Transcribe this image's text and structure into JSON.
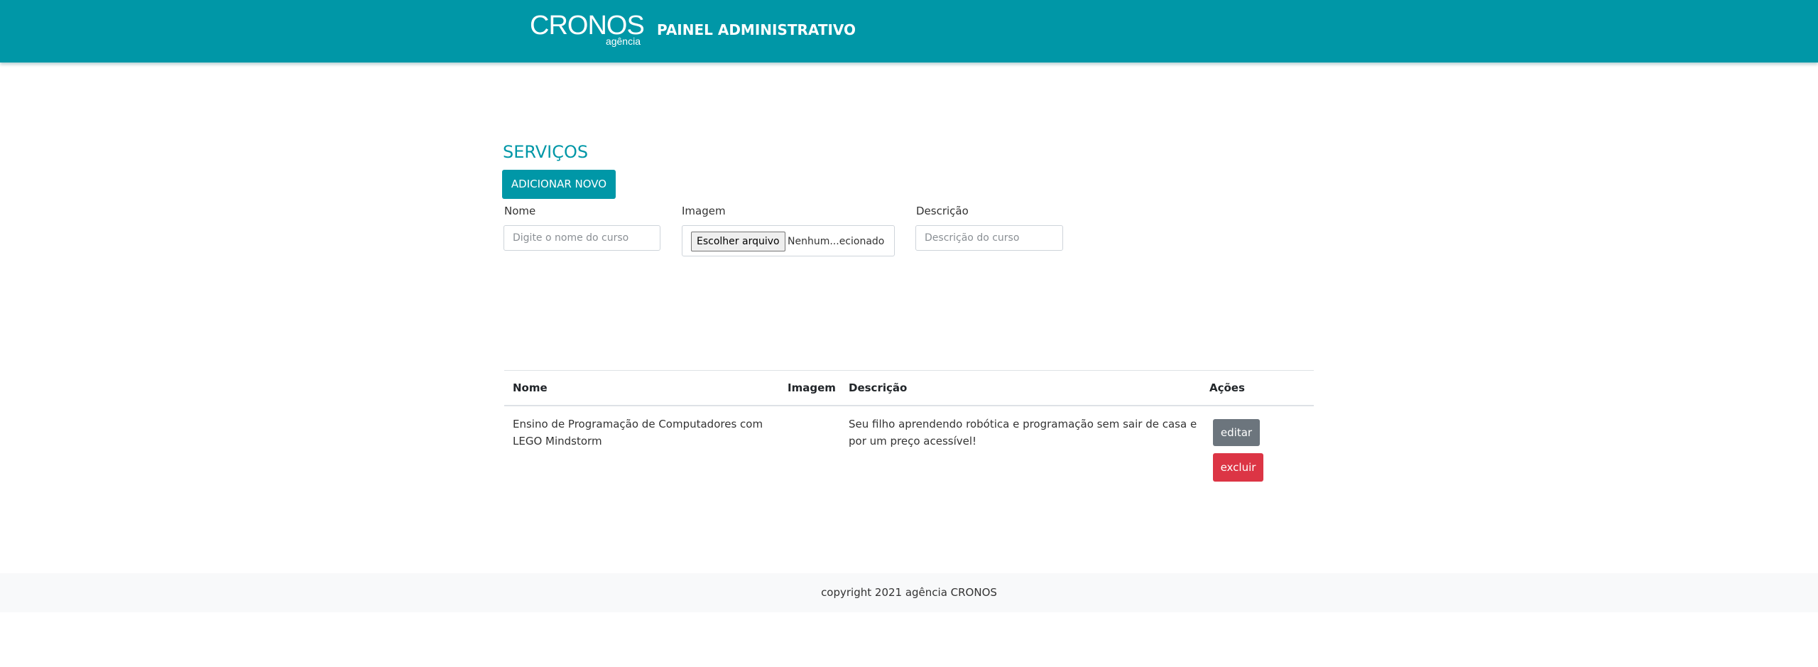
{
  "header": {
    "logo_main": "CRONOS",
    "logo_sub": "agência",
    "title": "PAINEL ADMINISTRATIVO",
    "background_color": "#0097a7"
  },
  "main": {
    "heading": "SERVIÇOS",
    "add_button_label": "ADICIONAR NOVO",
    "form": {
      "name_label": "Nome",
      "name_placeholder": "Digite o nome do curso",
      "image_label": "Imagem",
      "file_button_label": "Escolher arquivo",
      "file_status": "Nenhum...ecionado",
      "description_label": "Descrição",
      "description_placeholder": "Descrição do curso"
    },
    "table": {
      "columns": [
        "Nome",
        "Imagem",
        "Descrição",
        "Ações"
      ],
      "rows": [
        {
          "nome_line1": "Ensino de Programação de Computadores com",
          "nome_line2": "LEGO Mindstorm",
          "imagem": "",
          "descricao_line1": "Seu filho aprendendo robótica e programação sem sair de casa e",
          "descricao_line2": "por um preço acessível!",
          "edit_label": "editar",
          "delete_label": "excluir"
        }
      ]
    }
  },
  "footer": {
    "text": "copyright 2021 agência CRONOS"
  },
  "colors": {
    "accent": "#0097a7",
    "edit_button": "#6c757d",
    "delete_button": "#dc3545"
  }
}
